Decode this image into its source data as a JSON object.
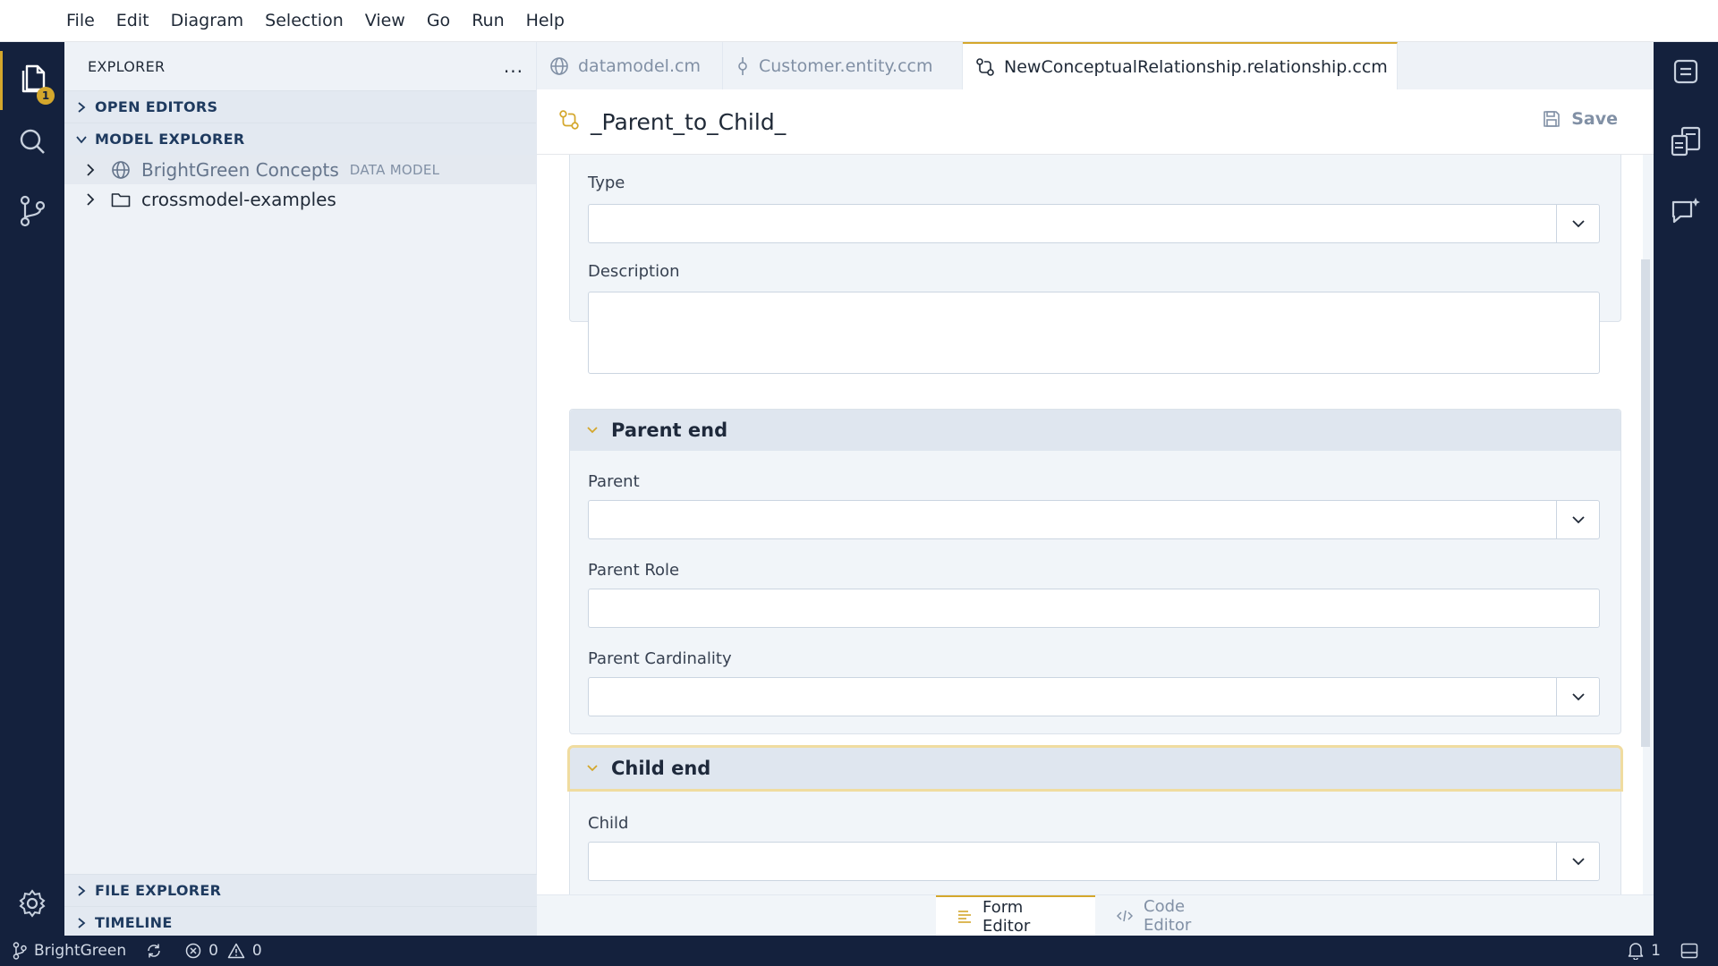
{
  "menubar": {
    "items": [
      "File",
      "Edit",
      "Diagram",
      "Selection",
      "View",
      "Go",
      "Run",
      "Help"
    ]
  },
  "activitybar": {
    "explorer_badge": "1"
  },
  "sidebar": {
    "title": "EXPLORER",
    "more_label": "...",
    "sections": {
      "open_editors": "OPEN EDITORS",
      "model_explorer": "MODEL EXPLORER",
      "file_explorer": "FILE EXPLORER",
      "timeline": "TIMELINE"
    },
    "tree": [
      {
        "label": "BrightGreen Concepts",
        "tag": "DATA MODEL"
      },
      {
        "label": "crossmodel-examples",
        "tag": ""
      }
    ]
  },
  "tabs": [
    {
      "label": "datamodel.cm",
      "icon": "globe-icon"
    },
    {
      "label": "Customer.entity.ccm",
      "icon": "entity-icon"
    },
    {
      "label": "NewConceptualRelationship.relationship.ccm",
      "icon": "relationship-icon"
    }
  ],
  "editor": {
    "title": "_Parent_to_Child_",
    "save_label": "Save",
    "general": {
      "type_label": "Type",
      "type_value": "",
      "description_label": "Description",
      "description_value": ""
    },
    "parent_end": {
      "header": "Parent end",
      "parent_label": "Parent",
      "parent_value": "",
      "parent_role_label": "Parent Role",
      "parent_role_value": "",
      "parent_cardinality_label": "Parent Cardinality",
      "parent_cardinality_value": ""
    },
    "child_end": {
      "header": "Child end",
      "child_label": "Child",
      "child_value": ""
    }
  },
  "mode_tabs": {
    "form_editor": "Form Editor",
    "code_editor": "Code Editor"
  },
  "statusbar": {
    "branch": "BrightGreen",
    "errors": "0",
    "warnings": "0",
    "notifications": "1"
  },
  "colors": {
    "accent": "#d4a72c",
    "dark_bar": "#14213d",
    "sidebar_bg": "#eef2f7"
  }
}
